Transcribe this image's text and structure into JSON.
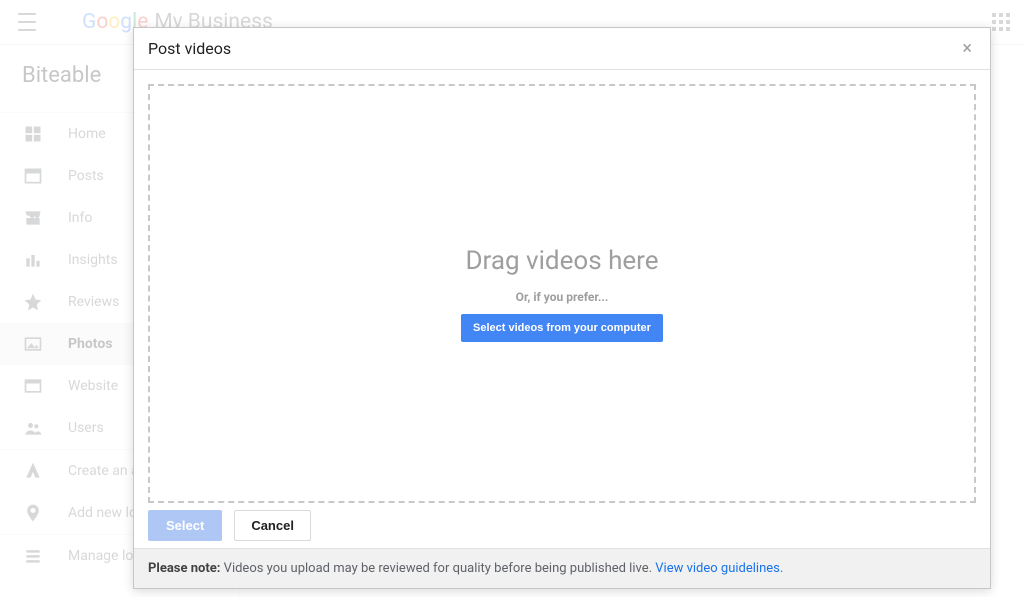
{
  "header": {
    "product_suffix": "My Business"
  },
  "sidebar": {
    "business_name": "Biteable",
    "items": [
      {
        "label": "Home",
        "icon": "home",
        "active": false
      },
      {
        "label": "Posts",
        "icon": "posts",
        "active": false
      },
      {
        "label": "Info",
        "icon": "store",
        "active": false
      },
      {
        "label": "Insights",
        "icon": "bars",
        "active": false
      },
      {
        "label": "Reviews",
        "icon": "star",
        "active": false
      },
      {
        "label": "Photos",
        "icon": "image",
        "active": true
      },
      {
        "label": "Website",
        "icon": "web",
        "active": false
      },
      {
        "label": "Users",
        "icon": "users",
        "active": false
      }
    ],
    "footer_items": [
      {
        "label": "Create an ad",
        "icon": "ads"
      },
      {
        "label": "Add new location",
        "icon": "pin"
      },
      {
        "label": "Manage locations",
        "icon": "list"
      }
    ]
  },
  "dialog": {
    "title": "Post videos",
    "dropzone": {
      "headline": "Drag videos here",
      "subtext": "Or, if you prefer...",
      "button": "Select videos from your computer"
    },
    "actions": {
      "select": "Select",
      "cancel": "Cancel"
    },
    "note": {
      "lead": "Please note:",
      "text": " Videos you upload may be reviewed for quality before being published live. ",
      "link": "View video guidelines."
    }
  }
}
